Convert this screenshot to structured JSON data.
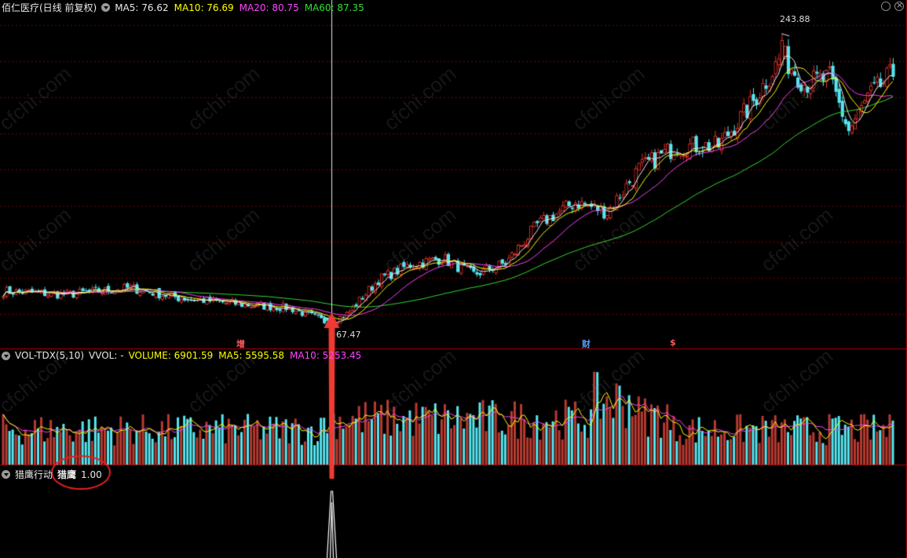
{
  "header": {
    "stock_name": "佰仁医疗(日线 前复权)",
    "ma_items": [
      {
        "label": "MA5: 76.62",
        "color": "#e8e8e8"
      },
      {
        "label": "MA10: 76.69",
        "color": "#ffff00"
      },
      {
        "label": "MA20: 80.75",
        "color": "#ff44ff"
      },
      {
        "label": "MA60: 87.35",
        "color": "#33dd33"
      }
    ]
  },
  "volume_header": {
    "name": "VOL-TDX(5,10)",
    "vvol": "VVOL: -",
    "items": [
      {
        "label": "VOLUME: 6901.59",
        "color": "#ffff00"
      },
      {
        "label": "MA5: 5595.58",
        "color": "#ffff00"
      },
      {
        "label": "MA10: 5253.45",
        "color": "#ff44ff"
      }
    ]
  },
  "indicator_header": {
    "name": "猎鹰行动",
    "label": "猎鹰",
    "value": "1.00"
  },
  "annotations": {
    "high_label": "243.88",
    "low_label": "67.47",
    "marker_1": "增",
    "marker_2": "财",
    "marker_3": "$"
  },
  "watermark": "cfchi.com",
  "colors": {
    "up": "#e0302a",
    "down": "#55e6f0",
    "ma5": "#e8e8e8",
    "ma10": "#ffff00",
    "ma20": "#ff44ff",
    "ma60": "#33dd33",
    "grid": "#7a0000",
    "arrow": "#f03a34"
  },
  "chart_data": {
    "type": "candlestick",
    "description": "Daily candlestick (forward-adjusted) with MA5/MA10/MA20/MA60, volume sub-chart and a signal indicator sub-chart",
    "price_range": [
      60,
      250
    ],
    "high": 243.88,
    "low": 67.47,
    "close_path": [
      {
        "t": 0,
        "p": 88
      },
      {
        "t": 20,
        "p": 86
      },
      {
        "t": 40,
        "p": 90
      },
      {
        "t": 55,
        "p": 84
      },
      {
        "t": 75,
        "p": 80
      },
      {
        "t": 90,
        "p": 78
      },
      {
        "t": 102,
        "p": 69
      },
      {
        "t": 108,
        "p": 74
      },
      {
        "t": 118,
        "p": 95
      },
      {
        "t": 128,
        "p": 104
      },
      {
        "t": 138,
        "p": 108
      },
      {
        "t": 148,
        "p": 98
      },
      {
        "t": 158,
        "p": 105
      },
      {
        "t": 168,
        "p": 128
      },
      {
        "t": 180,
        "p": 142
      },
      {
        "t": 190,
        "p": 136
      },
      {
        "t": 200,
        "p": 162
      },
      {
        "t": 212,
        "p": 176
      },
      {
        "t": 225,
        "p": 176
      },
      {
        "t": 235,
        "p": 200
      },
      {
        "t": 245,
        "p": 231
      },
      {
        "t": 252,
        "p": 214
      },
      {
        "t": 260,
        "p": 217
      },
      {
        "t": 266,
        "p": 185
      },
      {
        "t": 272,
        "p": 205
      },
      {
        "t": 280,
        "p": 220
      }
    ],
    "signal_day": 104,
    "indicator_value": 1.0,
    "volume_levels": {
      "volume": 6901.59,
      "ma5": 5595.58,
      "ma10": 5253.45
    }
  }
}
